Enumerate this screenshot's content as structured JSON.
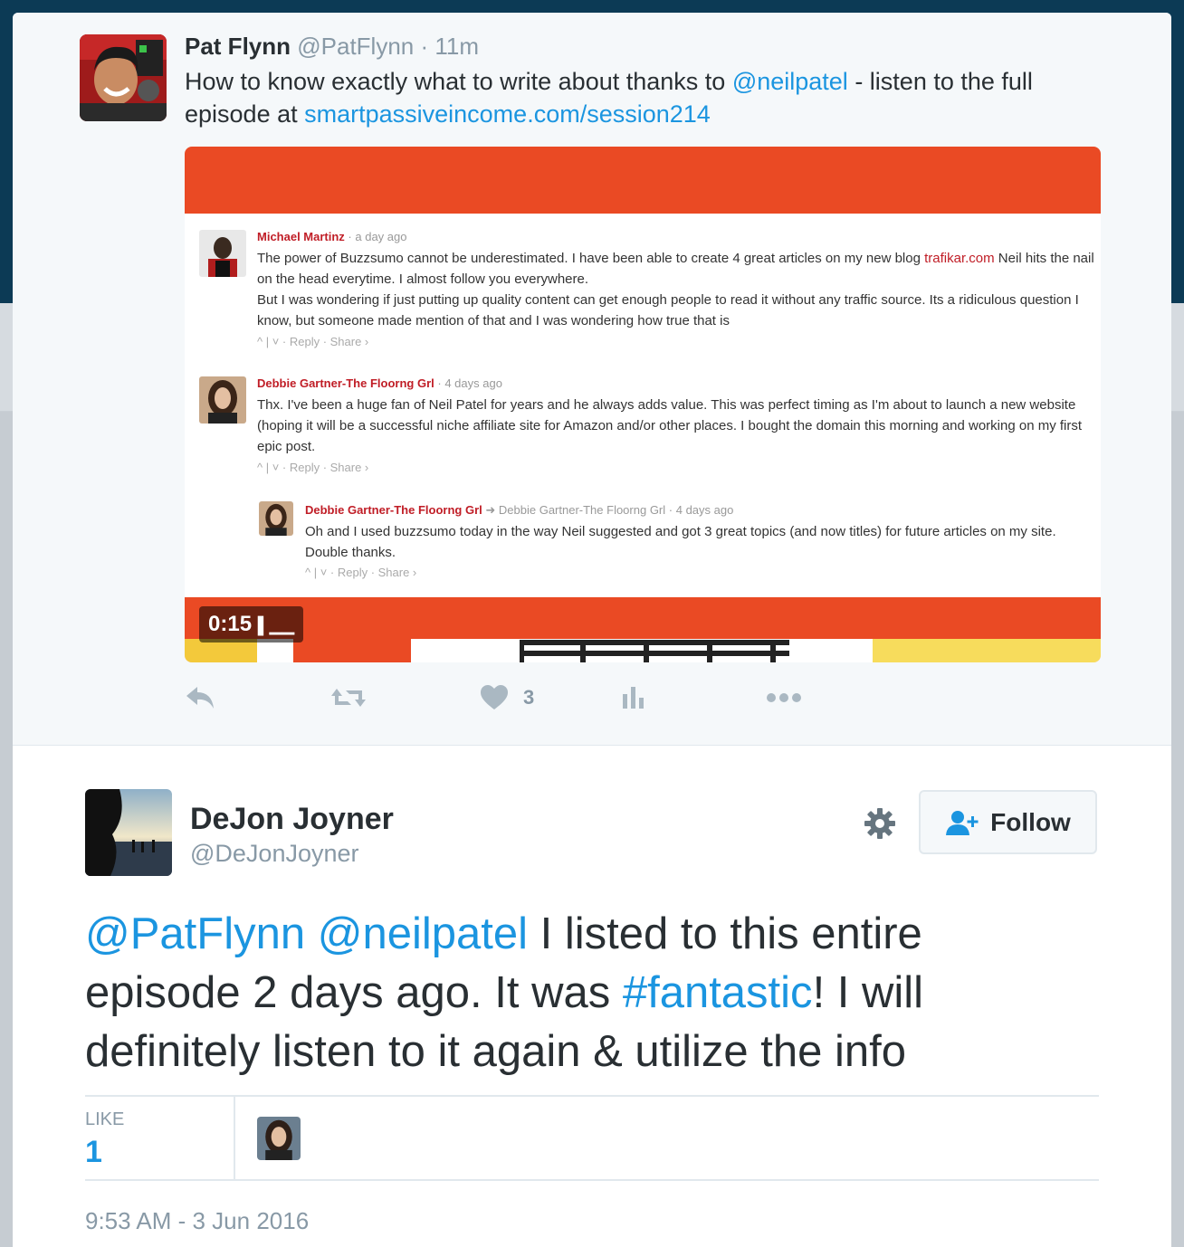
{
  "parent_tweet": {
    "author_name": "Pat Flynn",
    "author_handle": "@PatFlynn",
    "time_sep": "·",
    "time": "11m",
    "text_before_mention": "How to know exactly what to write about thanks to ",
    "mention": "@neilpatel",
    "text_after_mention": " - listen to the full episode at ",
    "link": "smartpassiveincome.com/session214",
    "video_duration": "0:15",
    "like_count": "3"
  },
  "comments": [
    {
      "name": "Michael Martinz",
      "time": "a day ago",
      "body_before_link": "The power of Buzzsumo cannot be underestimated. I have been able to create 4 great articles on my new blog ",
      "link": "trafikar.com",
      "body_after_link": " Neil hits the nail on the head everytime. I almost follow you everywhere.",
      "body_line2": "But I was wondering if just putting up quality content can get enough people to read it without any traffic source. Its a ridiculous question I know, but someone made mention of that and I was wondering how true that is",
      "actions": "^  |  ˅  ·  Reply  ·  Share ›"
    },
    {
      "name": "Debbie Gartner-The Floorng Grl",
      "time": "4 days ago",
      "body": "Thx. I've been a huge fan of Neil Patel for years and he always adds value. This was perfect timing as I'm about to launch a new website (hoping it will be a successful niche affiliate site for Amazon and/or other places. I bought the domain this morning and working on my first epic post.",
      "actions": "^  |  ˅  ·  Reply  ·  Share ›"
    },
    {
      "name": "Debbie Gartner-The Floorng Grl",
      "reply_to": "Debbie Gartner-The Floorng Grl",
      "time": "4 days ago",
      "body": "Oh and I used buzzsumo today in the way Neil suggested and got 3 great topics (and now titles) for future articles on my site. Double thanks.",
      "actions": "^  |  ˅  ·  Reply  ·  Share ›"
    }
  ],
  "main_tweet": {
    "author_name": "DeJon Joyner",
    "author_handle": "@DeJonJoyner",
    "follow_label": "Follow",
    "mention1": "@PatFlynn",
    "mention2": "@neilpatel",
    "text_part1": " I listed to this entire episode 2 days ago. It was ",
    "hashtag": "#fantastic",
    "text_part2": "! I will definitely listen to it again & utilize the info",
    "like_label": "LIKE",
    "like_value": "1",
    "timestamp": "9:53 AM - 3 Jun 2016"
  },
  "icons": [
    "reply-icon",
    "retweet-icon",
    "heart-icon",
    "analytics-icon",
    "more-icon",
    "gear-icon",
    "follow-person-icon"
  ],
  "colors": {
    "link": "#1b95e0",
    "header_bg": "#0c3a55",
    "video_orange": "#ea4a24",
    "comment_name_red": "#c01d26"
  }
}
